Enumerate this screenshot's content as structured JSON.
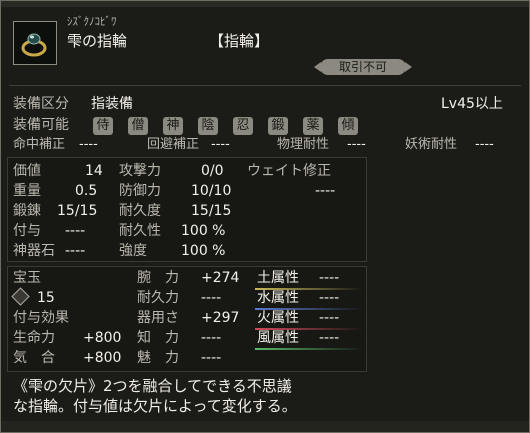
{
  "item": {
    "reading": "ｼｽﾞｸﾉｺﾋﾞﾜ",
    "name": "雫の指輪",
    "type": "【指輪】",
    "tradable": "取引不可"
  },
  "equip": {
    "category_label": "装備区分",
    "category_value": "指装備",
    "level": "Lv45以上",
    "jobs_label": "装備可能",
    "jobs": [
      "侍",
      "僧",
      "神",
      "陰",
      "忍",
      "鍛",
      "薬",
      "傾"
    ]
  },
  "corrections": {
    "hit_label": "命中補正",
    "hit_value": "----",
    "evade_label": "回避補正",
    "evade_value": "----",
    "phys_label": "物理耐性",
    "phys_value": "----",
    "magic_label": "妖術耐性",
    "magic_value": "----"
  },
  "stats": {
    "value_label": "価値",
    "value": "14",
    "weight_label": "重量",
    "weight": "0.5",
    "forge_label": "鍛錬",
    "forge": "15/15",
    "enchant_label": "付与",
    "enchant": "----",
    "jinki_label": "神器石",
    "jinki": "----",
    "attack_label": "攻撃力",
    "attack": "0/0",
    "defense_label": "防御力",
    "defense": "10/10",
    "durability_label": "耐久度",
    "durability": "15/15",
    "durability_pct_label": "耐久性",
    "durability_pct": "100 %",
    "strength_label": "強度",
    "strength": "100 %",
    "weight_fix_label": "ウェイト修正",
    "weight_fix": "----"
  },
  "gems": {
    "label": "宝玉",
    "count": "15",
    "effects_label": "付与効果"
  },
  "effects": [
    {
      "label": "生命力",
      "value": "+800"
    },
    {
      "label": "気　合",
      "value": "+800"
    }
  ],
  "attributes": [
    {
      "label": "腕　力",
      "value": "+274"
    },
    {
      "label": "耐久力",
      "value": "----"
    },
    {
      "label": "器用さ",
      "value": "+297"
    },
    {
      "label": "知　力",
      "value": "----"
    },
    {
      "label": "魅　力",
      "value": "----"
    }
  ],
  "elements": [
    {
      "label": "土属性",
      "value": "----",
      "color": "#c9b95a"
    },
    {
      "label": "水属性",
      "value": "----",
      "color": "#5a7ad0"
    },
    {
      "label": "火属性",
      "value": "----",
      "color": "#d04a5a"
    },
    {
      "label": "風属性",
      "value": "----",
      "color": "#5ab86a"
    }
  ],
  "description": {
    "line1": "《雫の欠片》2つを融合してできる不思議",
    "line2": "な指輪。付与値は欠片によって変化する。"
  }
}
